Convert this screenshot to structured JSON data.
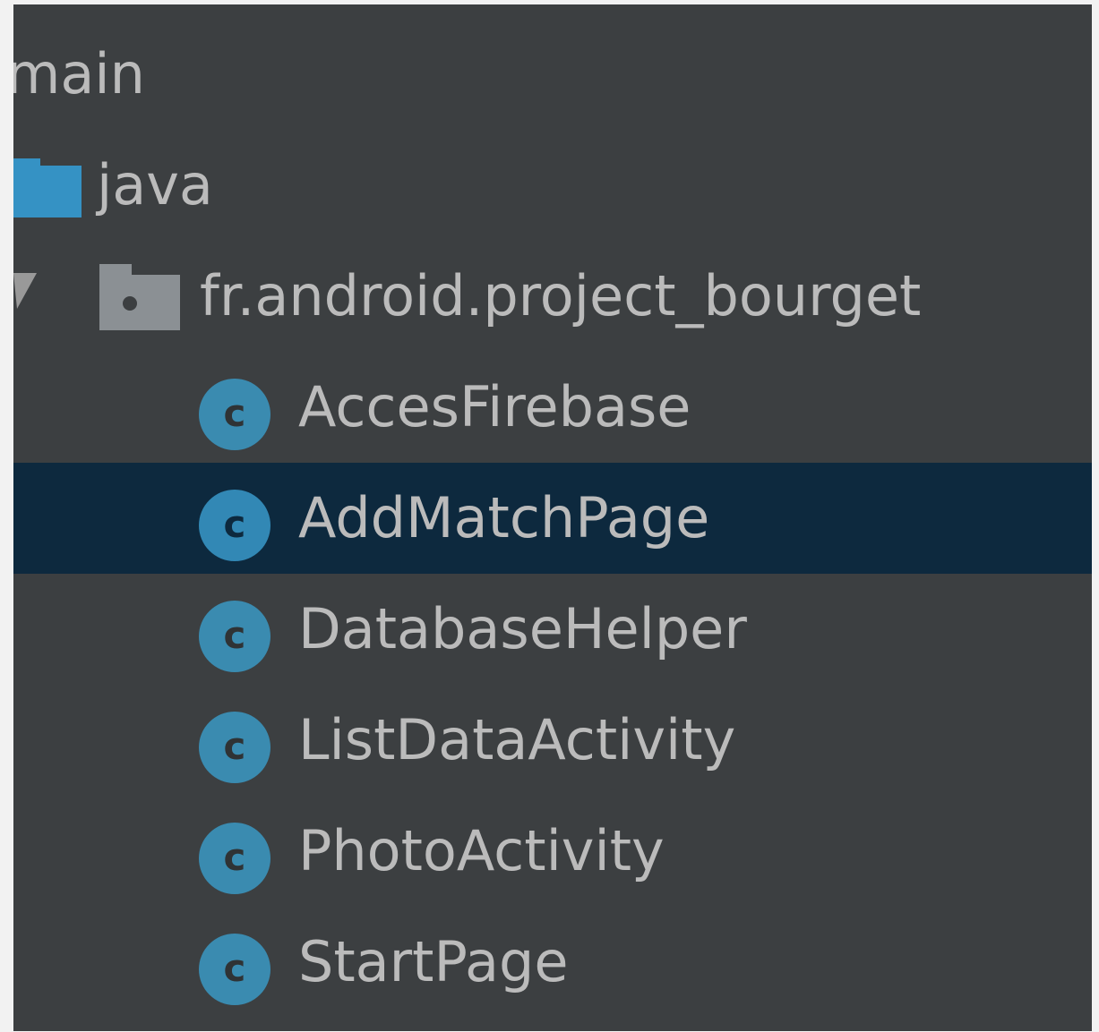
{
  "tree": {
    "root": {
      "label": "main"
    },
    "source_folder": {
      "label": "java",
      "icon": "source-folder-icon",
      "color": "#3592c4"
    },
    "package": {
      "label": "fr.android.project_bourget",
      "icon": "package-folder-icon",
      "expanded": true
    },
    "classes": [
      {
        "label": "AccesFirebase",
        "icon": "class-icon",
        "selected": false
      },
      {
        "label": "AddMatchPage",
        "icon": "class-icon",
        "selected": true
      },
      {
        "label": "DatabaseHelper",
        "icon": "class-icon",
        "selected": false
      },
      {
        "label": "ListDataActivity",
        "icon": "class-icon",
        "selected": false
      },
      {
        "label": "PhotoActivity",
        "icon": "class-icon",
        "selected": false
      },
      {
        "label": "StartPage",
        "icon": "class-icon",
        "selected": false
      }
    ]
  },
  "colors": {
    "panel_background": "#3c3f41",
    "selection_background": "#0d293e",
    "text": "#bbbbbb",
    "class_icon": "#3a8bb0"
  }
}
